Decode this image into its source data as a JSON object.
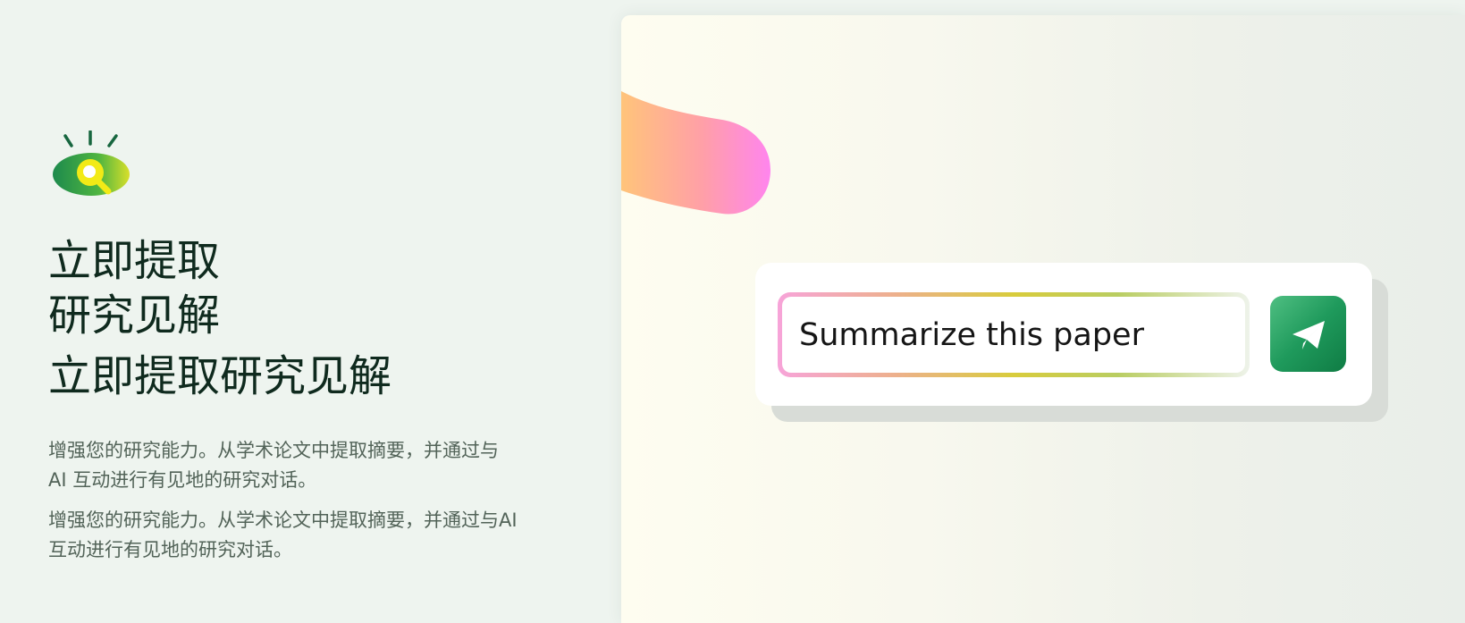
{
  "logo": {
    "icon": "eye-magnifier-icon"
  },
  "headline": {
    "line1": "立即提取",
    "line2": "研究见解",
    "line3": "立即提取研究见解"
  },
  "description": {
    "first": {
      "line1": "增强您的研究能力。从学术论文中提取摘要，并通过与",
      "line2": "AI 互动进行有见地的研究对话。"
    },
    "second": {
      "line1": "增强您的研究能力。从学术论文中提取摘要，并通过与AI",
      "line2": "互动进行有见地的研究对话。"
    }
  },
  "hero": {
    "prompt_text": "Summarize this paper",
    "send_icon": "paper-plane-icon"
  },
  "colors": {
    "accent_green": "#1f9a5c",
    "heading": "#0f2a1e",
    "body_text": "#526358",
    "background": "#eef4ef"
  }
}
